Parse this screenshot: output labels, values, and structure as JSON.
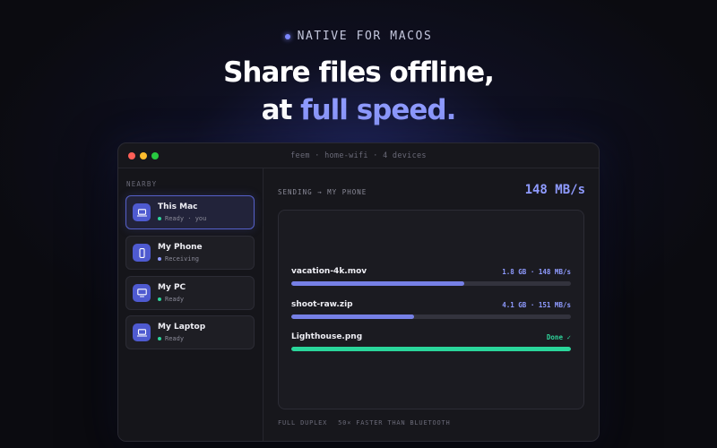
{
  "hero": {
    "eyebrow": "NATIVE FOR MACOS",
    "headline_line1": "Share files offline,",
    "headline_line2_prefix": "at ",
    "headline_line2_accent": "full speed."
  },
  "window": {
    "title": "feem · home-wifi · 4 devices"
  },
  "sidebar": {
    "header": "NEARBY",
    "devices": [
      {
        "name": "This Mac",
        "status": "Ready · you",
        "status_color": "#2fd39a",
        "icon": "laptop-icon",
        "active": true
      },
      {
        "name": "My Phone",
        "status": "Receiving",
        "status_color": "#8f9bff",
        "icon": "phone-icon",
        "active": false
      },
      {
        "name": "My PC",
        "status": "Ready",
        "status_color": "#2fd39a",
        "icon": "monitor-icon",
        "active": false
      },
      {
        "name": "My Laptop",
        "status": "Ready",
        "status_color": "#2fd39a",
        "icon": "laptop-icon",
        "active": false
      }
    ]
  },
  "main": {
    "sending_label": "SENDING → MY PHONE",
    "speed": "148 MB/s",
    "transfers": [
      {
        "name": "vacation-4k.mov",
        "meta": "1.8 GB · 148 MB/s",
        "progress": 0.62,
        "done": false
      },
      {
        "name": "shoot-raw.zip",
        "meta": "4.1 GB · 151 MB/s",
        "progress": 0.44,
        "done": false
      },
      {
        "name": "Lighthouse.png",
        "meta": "Done ✓",
        "progress": 1.0,
        "done": true
      }
    ],
    "footer": [
      "FULL DUPLEX",
      "50× FASTER THAN BLUETOOTH"
    ]
  },
  "colors": {
    "accent": "#8f9bff",
    "success": "#2fd39a"
  }
}
